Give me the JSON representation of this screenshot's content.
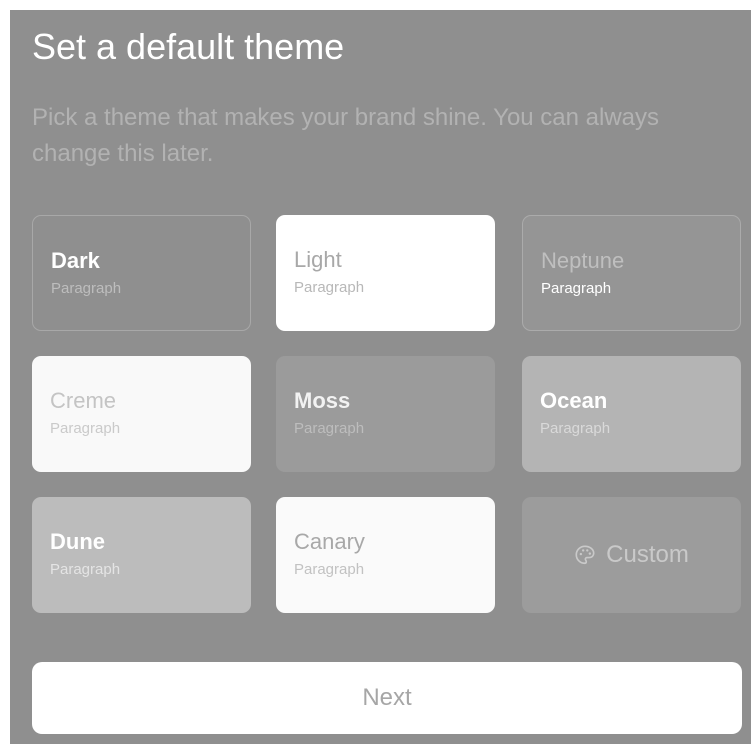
{
  "header": {
    "title": "Set a default theme",
    "subtitle": "Pick a theme that makes your brand shine. You can always change this later."
  },
  "themes": [
    {
      "name": "Dark",
      "description": "Paragraph"
    },
    {
      "name": "Light",
      "description": "Paragraph"
    },
    {
      "name": "Neptune",
      "description": "Paragraph"
    },
    {
      "name": "Creme",
      "description": "Paragraph"
    },
    {
      "name": "Moss",
      "description": "Paragraph"
    },
    {
      "name": "Ocean",
      "description": "Paragraph"
    },
    {
      "name": "Dune",
      "description": "Paragraph"
    },
    {
      "name": "Canary",
      "description": "Paragraph"
    }
  ],
  "custom": {
    "label": "Custom",
    "icon": "palette-icon"
  },
  "footer": {
    "next_label": "Next"
  },
  "colors": {
    "overlay": "#8f8f8f",
    "card_white": "#ffffff"
  }
}
